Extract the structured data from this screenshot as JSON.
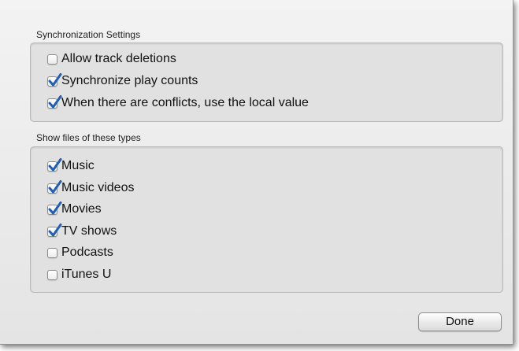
{
  "sync_settings": {
    "title": "Synchronization Settings",
    "options": [
      {
        "label": "Allow track deletions",
        "checked": false
      },
      {
        "label": "Synchronize play counts",
        "checked": true
      },
      {
        "label": "When there are conflicts, use the local value",
        "checked": true
      }
    ]
  },
  "file_types": {
    "title": "Show files of these types",
    "options": [
      {
        "label": "Music",
        "checked": true
      },
      {
        "label": "Music videos",
        "checked": true
      },
      {
        "label": "Movies",
        "checked": true
      },
      {
        "label": "TV shows",
        "checked": true
      },
      {
        "label": "Podcasts",
        "checked": false
      },
      {
        "label": "iTunes U",
        "checked": false
      }
    ]
  },
  "done_button": {
    "label": "Done"
  },
  "colors": {
    "checkmark": "#1f5fb8"
  }
}
